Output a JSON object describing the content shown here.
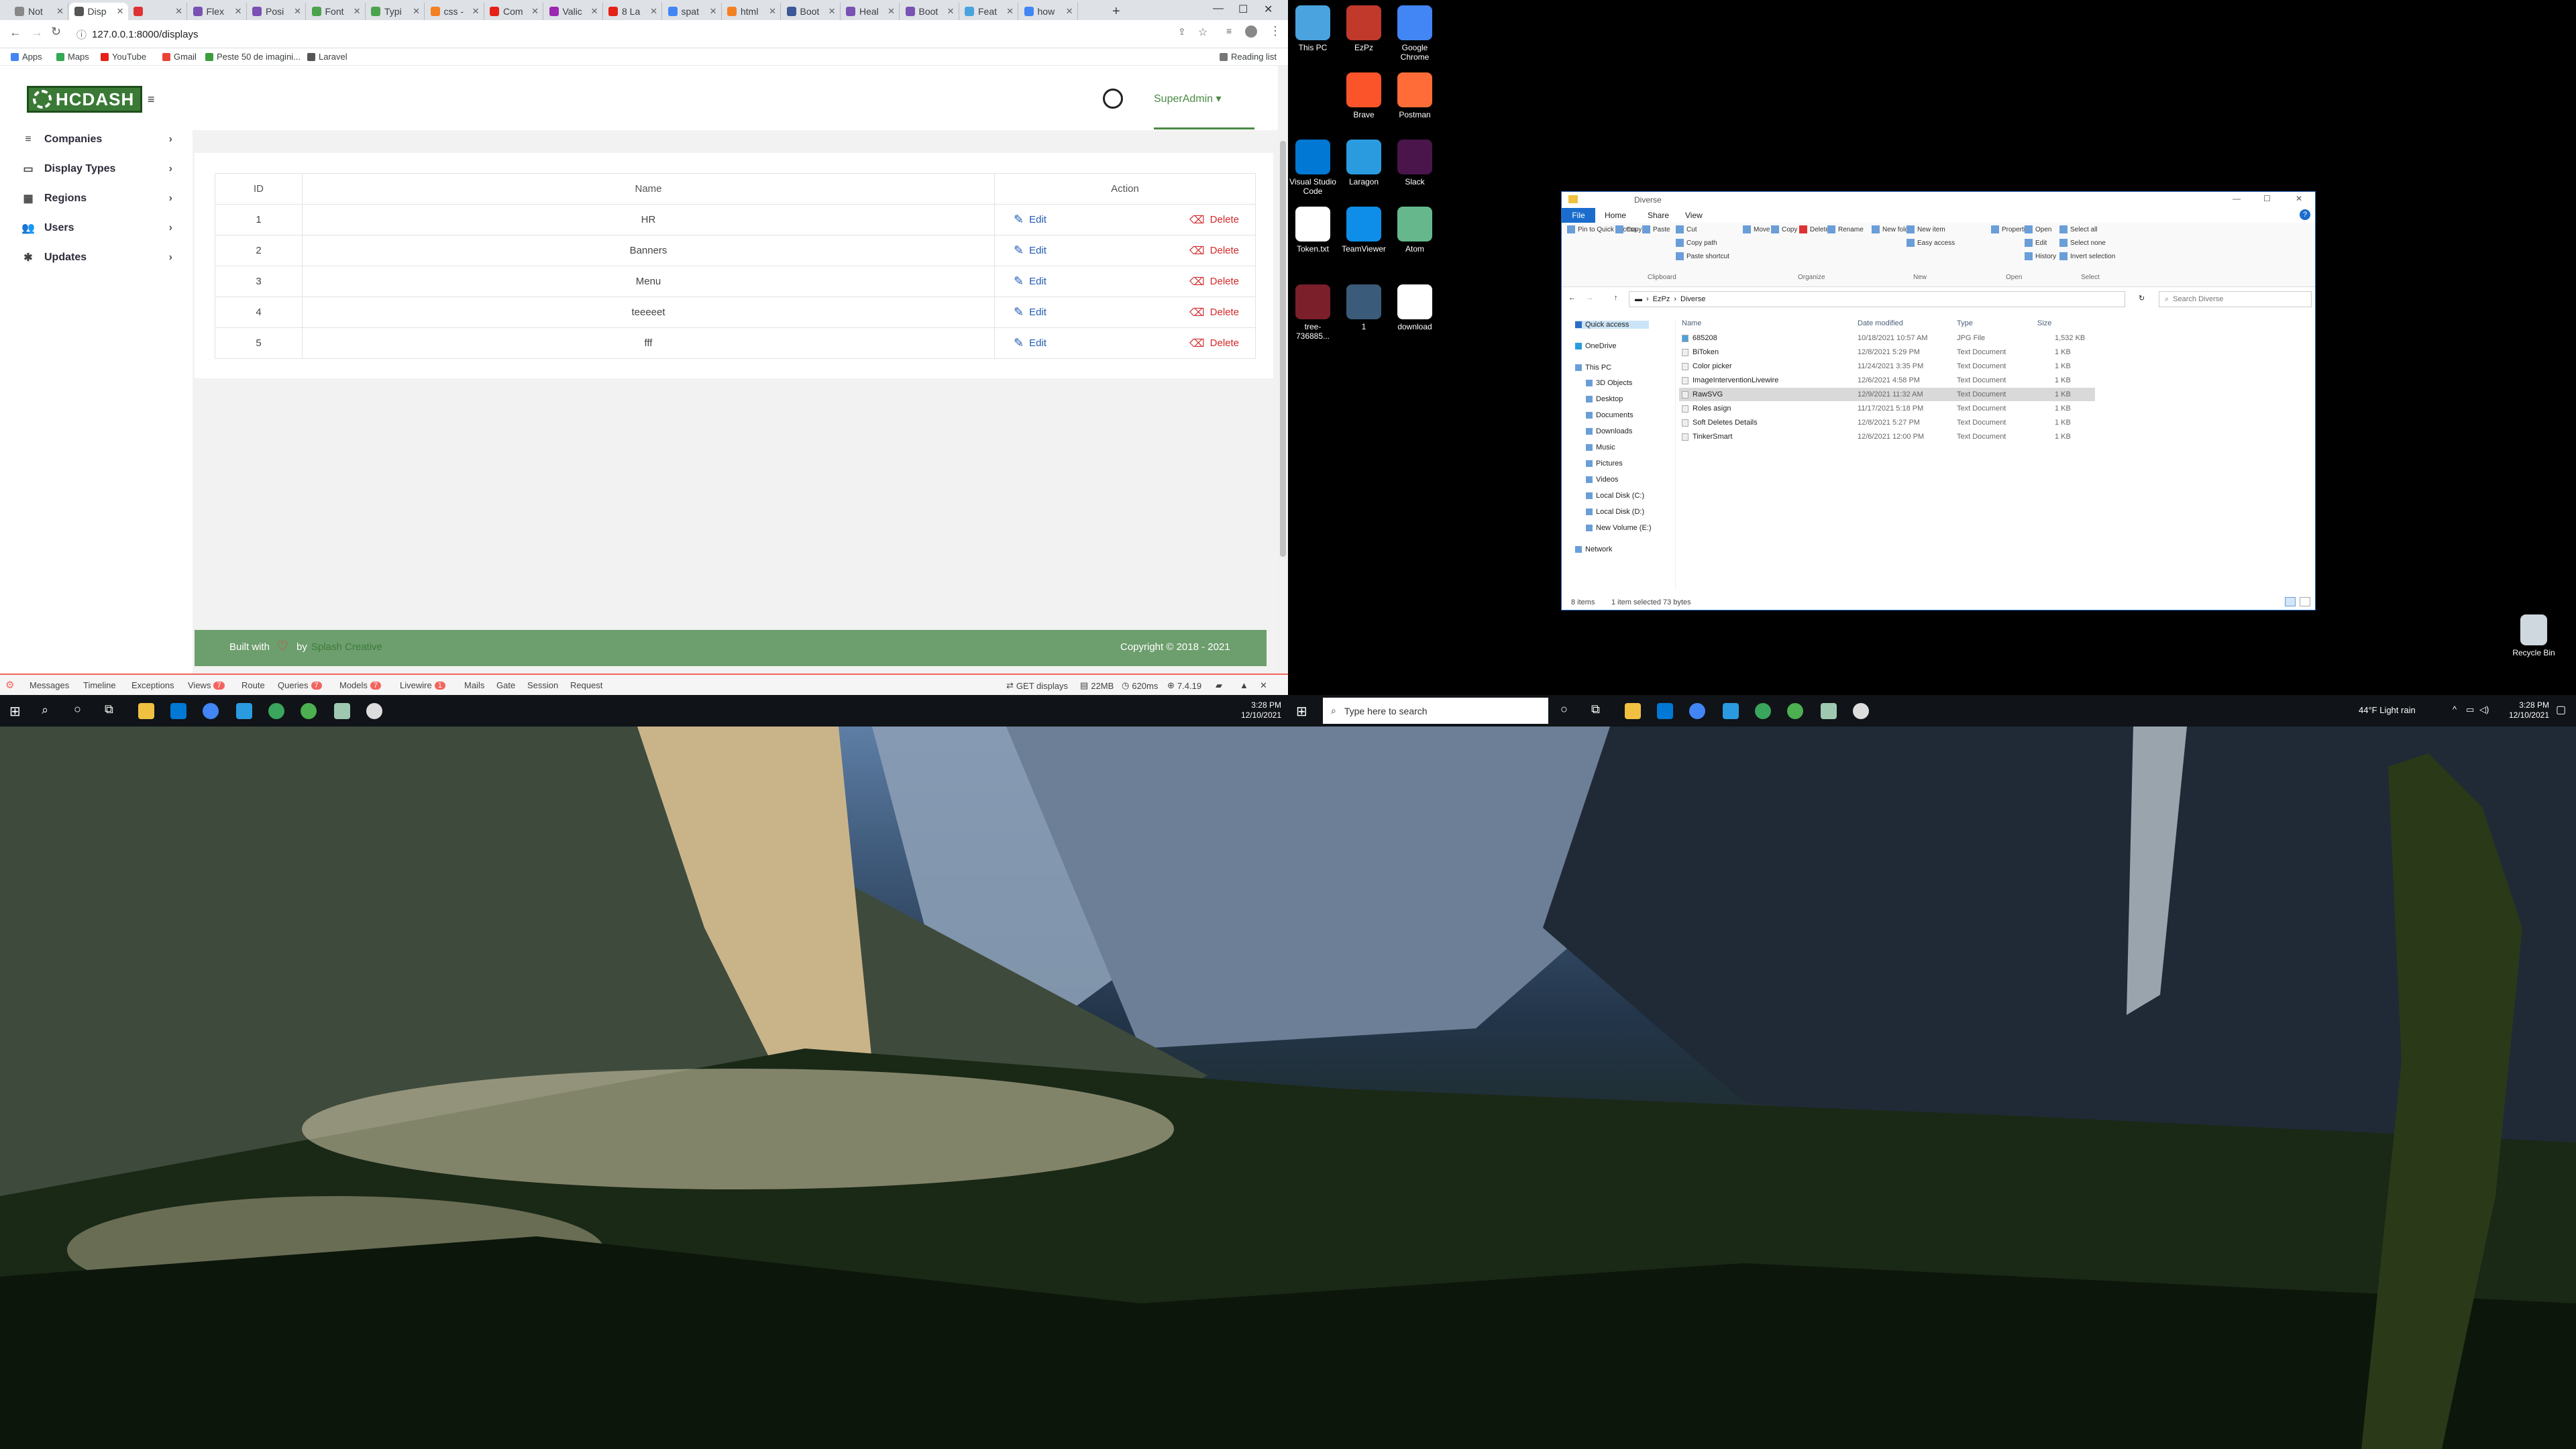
{
  "browser": {
    "tabs": [
      {
        "label": "Not",
        "color": "#888888"
      },
      {
        "label": "Disp",
        "color": "#555555",
        "active": true
      },
      {
        "label": "",
        "color": "#d33"
      },
      {
        "label": "Flex",
        "color": "#7952b3"
      },
      {
        "label": "Posi",
        "color": "#7952b3"
      },
      {
        "label": "Font",
        "color": "#4ca34c"
      },
      {
        "label": "Typi",
        "color": "#4ca34c"
      },
      {
        "label": "css -",
        "color": "#f48024"
      },
      {
        "label": "Com",
        "color": "#e62117"
      },
      {
        "label": "Valic",
        "color": "#9c27b0"
      },
      {
        "label": "8 La",
        "color": "#e62117"
      },
      {
        "label": "spat",
        "color": "#4285f4"
      },
      {
        "label": "html",
        "color": "#f48024"
      },
      {
        "label": "Boot",
        "color": "#3b5998"
      },
      {
        "label": "Heal",
        "color": "#7952b3"
      },
      {
        "label": "Boot",
        "color": "#7952b3"
      },
      {
        "label": "Feat",
        "color": "#4aa3df"
      },
      {
        "label": "how",
        "color": "#4285f4"
      }
    ],
    "new_tab": "+",
    "minimize": "—",
    "maximize": "☐",
    "close": "✕",
    "url": "127.0.0.1:8000/displays",
    "bookmarks": [
      "Apps",
      "Maps",
      "YouTube",
      "Gmail",
      "Peste 50 de imagini...",
      "Laravel"
    ],
    "reading_list": "Reading list"
  },
  "app": {
    "logo": "HCDASH",
    "nav": [
      {
        "label": "Companies",
        "icon": "≡"
      },
      {
        "label": "Display Types",
        "icon": "▭"
      },
      {
        "label": "Regions",
        "icon": "▦"
      },
      {
        "label": "Users",
        "icon": "👥"
      },
      {
        "label": "Updates",
        "icon": "✱"
      }
    ],
    "user": "SuperAdmin ▾",
    "table": {
      "headers": [
        "ID",
        "Name",
        "Action"
      ],
      "rows": [
        {
          "id": "1",
          "name": "HR"
        },
        {
          "id": "2",
          "name": "Banners"
        },
        {
          "id": "3",
          "name": "Menu"
        },
        {
          "id": "4",
          "name": "teeeeet"
        },
        {
          "id": "5",
          "name": "fff"
        }
      ],
      "edit_label": "Edit",
      "delete_label": "Delete"
    },
    "footer": {
      "built_with": "Built with",
      "by": "by",
      "brand": "Splash Creative",
      "copyright": "Copyright © 2018 - 2021"
    }
  },
  "debugbar": {
    "tabs": [
      "Messages",
      "Timeline",
      "Exceptions",
      "Views",
      "Route",
      "Queries",
      "Models",
      "Livewire",
      "Mails",
      "Gate",
      "Session",
      "Request"
    ],
    "badges": {
      "Views": "7",
      "Queries": "7",
      "Models": "7",
      "Livewire": "1"
    },
    "route": "GET displays",
    "memory": "22MB",
    "time": "620ms",
    "php": "7.4.19"
  },
  "taskbar_left": {
    "time": "3:28 PM",
    "date": "12/10/2021"
  },
  "taskbar_right": {
    "search_placeholder": "Type here to search",
    "weather": "44°F  Light rain",
    "time": "3:28 PM",
    "date": "12/10/2021"
  },
  "desktop_icons": [
    {
      "label": "This PC",
      "color": "#4aa3df"
    },
    {
      "label": "EzPz",
      "color": "#c0392b"
    },
    {
      "label": "Google Chrome",
      "color": "#4285f4"
    },
    {
      "label": "Brave",
      "color": "#fb542b"
    },
    {
      "label": "Postman",
      "color": "#ff6c37"
    },
    {
      "label": "Visual Studio Code",
      "color": "#0078d4"
    },
    {
      "label": "Laragon",
      "color": "#2b9be0"
    },
    {
      "label": "Slack",
      "color": "#4a154b"
    },
    {
      "label": "Token.txt",
      "color": "#ffffff"
    },
    {
      "label": "TeamViewer",
      "color": "#0e8ee9"
    },
    {
      "label": "Atom",
      "color": "#66b88c"
    },
    {
      "label": "tree-736885...",
      "color": "#7b1f2b"
    },
    {
      "label": "1",
      "color": "#3b5b7a"
    },
    {
      "label": "download",
      "color": "#ffffff"
    }
  ],
  "recycle_bin": "Recycle Bin",
  "explorer": {
    "title": "Diverse",
    "tabs": [
      "File",
      "Home",
      "Share",
      "View"
    ],
    "ribbon_groups": [
      "Clipboard",
      "Organize",
      "New",
      "Open",
      "Select"
    ],
    "ribbon_buttons": [
      "Pin to Quick access",
      "Copy",
      "Paste",
      "Cut",
      "Copy path",
      "Paste shortcut",
      "Move to",
      "Copy to",
      "Delete",
      "Rename",
      "New folder",
      "New item",
      "Easy access",
      "Properties",
      "Open",
      "Edit",
      "History",
      "Select all",
      "Select none",
      "Invert selection"
    ],
    "path": [
      "EzPz",
      "Diverse"
    ],
    "search_placeholder": "Search Diverse",
    "nav": [
      "Quick access",
      "OneDrive",
      "This PC",
      "3D Objects",
      "Desktop",
      "Documents",
      "Downloads",
      "Music",
      "Pictures",
      "Videos",
      "Local Disk (C:)",
      "Local Disk (D:)",
      "New Volume (E:)",
      "Network"
    ],
    "columns": [
      "Name",
      "Date modified",
      "Type",
      "Size"
    ],
    "files": [
      {
        "name": "685208",
        "date": "10/18/2021 10:57 AM",
        "type": "JPG File",
        "size": "1,532 KB",
        "icon": "#4aa3df"
      },
      {
        "name": "BiToken",
        "date": "12/8/2021 5:29 PM",
        "type": "Text Document",
        "size": "1 KB",
        "icon": "#eeeeee"
      },
      {
        "name": "Color picker",
        "date": "11/24/2021 3:35 PM",
        "type": "Text Document",
        "size": "1 KB",
        "icon": "#eeeeee"
      },
      {
        "name": "ImageInterventionLivewire",
        "date": "12/6/2021 4:58 PM",
        "type": "Text Document",
        "size": "1 KB",
        "icon": "#eeeeee"
      },
      {
        "name": "RawSVG",
        "date": "12/9/2021 11:32 AM",
        "type": "Text Document",
        "size": "1 KB",
        "icon": "#eeeeee",
        "selected": true
      },
      {
        "name": "Roles asign",
        "date": "11/17/2021 5:18 PM",
        "type": "Text Document",
        "size": "1 KB",
        "icon": "#eeeeee"
      },
      {
        "name": "Soft Deletes Details",
        "date": "12/8/2021 5:27 PM",
        "type": "Text Document",
        "size": "1 KB",
        "icon": "#eeeeee"
      },
      {
        "name": "TinkerSmart",
        "date": "12/6/2021 12:00 PM",
        "type": "Text Document",
        "size": "1 KB",
        "icon": "#eeeeee"
      }
    ],
    "status_items": "8 items",
    "status_selected": "1 item selected  73 bytes"
  }
}
